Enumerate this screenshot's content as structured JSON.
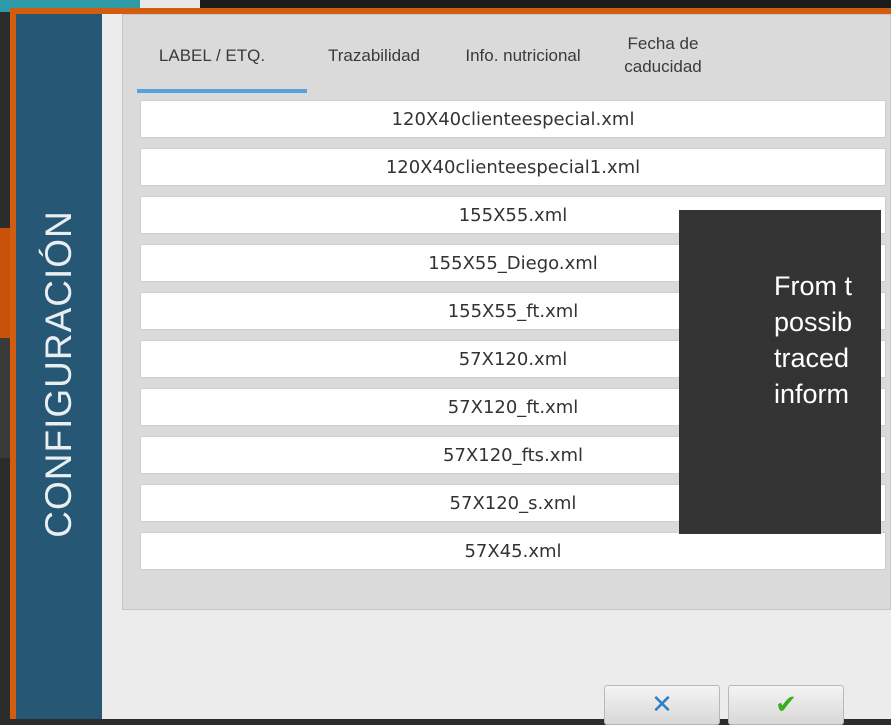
{
  "sidebar": {
    "title": "CONFIGURACIÓN"
  },
  "tabs": [
    {
      "label": "LABEL / ETQ.",
      "active": true
    },
    {
      "label": "Trazabilidad",
      "active": false
    },
    {
      "label": "Info. nutricional",
      "active": false
    },
    {
      "label": "Fecha de\ncaducidad",
      "active": false
    }
  ],
  "files": [
    "120X40clienteespecial.xml",
    "120X40clienteespecial1.xml",
    "155X55.xml",
    "155X55_Diego.xml",
    "155X55_ft.xml",
    "57X120.xml",
    "57X120_ft.xml",
    "57X120_fts.xml",
    "57X120_s.xml",
    "57X45.xml"
  ],
  "tooltip": {
    "text": "From t\npossib\ntraced\ninform"
  },
  "buttons": {
    "cancel_icon": "✕",
    "ok_icon": "✔"
  },
  "colors": {
    "accent": "#d35d0e",
    "sidebar": "#265774",
    "tab_underline": "#5aa0dc"
  }
}
